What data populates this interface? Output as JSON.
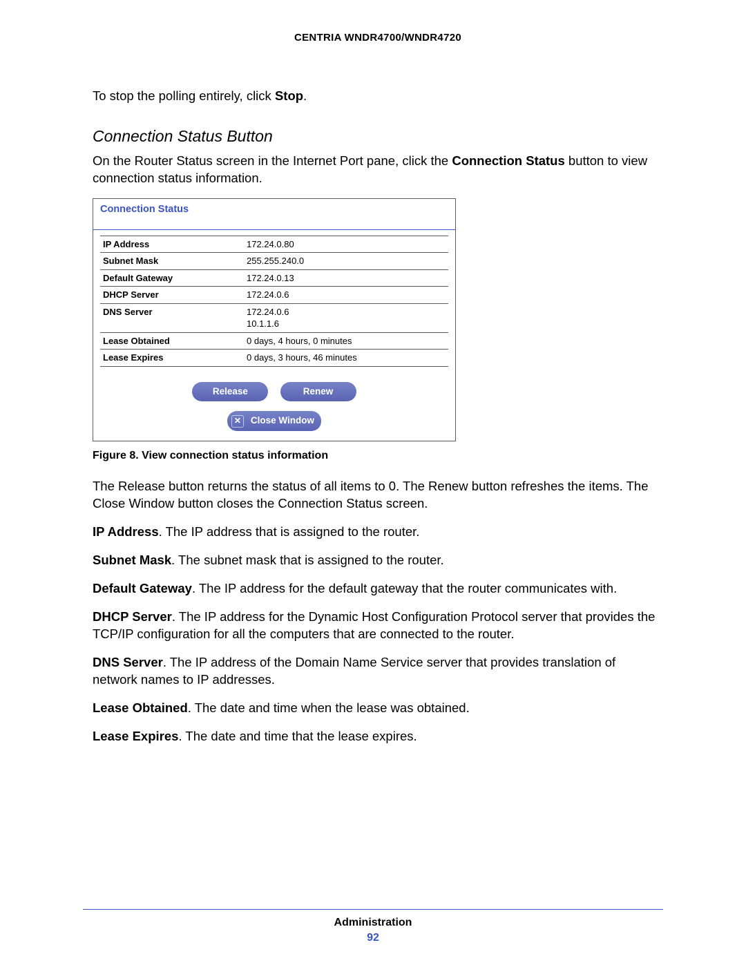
{
  "header": {
    "product": "CENTRIA WNDR4700/WNDR4720"
  },
  "intro": {
    "stop_line_pre": "To stop the polling entirely, click ",
    "stop_word": "Stop",
    "stop_line_post": "."
  },
  "section": {
    "heading": "Connection Status Button"
  },
  "paragraph1": {
    "pre": "On the Router Status screen in the Internet Port pane, click the ",
    "bold": "Connection Status",
    "post": " button to view connection status information."
  },
  "figure": {
    "title": "Connection Status",
    "rows": [
      {
        "label": "IP Address",
        "value": "172.24.0.80"
      },
      {
        "label": "Subnet Mask",
        "value": "255.255.240.0"
      },
      {
        "label": "Default Gateway",
        "value": "172.24.0.13"
      },
      {
        "label": "DHCP Server",
        "value": "172.24.0.6"
      },
      {
        "label": "DNS Server",
        "value": "172.24.0.6\n10.1.1.6"
      },
      {
        "label": "Lease Obtained",
        "value": "0 days, 4 hours, 0 minutes"
      },
      {
        "label": "Lease Expires",
        "value": "0 days, 3 hours, 46 minutes"
      }
    ],
    "buttons": {
      "release": "Release",
      "renew": "Renew",
      "close": "Close Window"
    },
    "caption": "Figure 8. View connection status information"
  },
  "paragraph2": "The Release button returns the status of all items to 0. The Renew button refreshes the items. The Close Window button closes the Connection Status screen.",
  "defs": [
    {
      "term": "IP Address",
      "text": ". The IP address that is assigned to the router."
    },
    {
      "term": "Subnet Mask",
      "text": ". The subnet mask that is assigned to the router."
    },
    {
      "term": "Default Gateway",
      "text": ". The IP address for the default gateway that the router communicates with."
    },
    {
      "term": "DHCP Server",
      "text": ". The IP address for the Dynamic Host Configuration Protocol server that provides the TCP/IP configuration for all the computers that are connected to the router."
    },
    {
      "term": "DNS Server",
      "text": ". The IP address of the Domain Name Service server that provides translation of network names to IP addresses."
    },
    {
      "term": "Lease Obtained",
      "text": ". The date and time when the lease was obtained."
    },
    {
      "term": "Lease Expires",
      "text": ". The date and time that the lease expires."
    }
  ],
  "footer": {
    "section": "Administration",
    "page": "92"
  }
}
